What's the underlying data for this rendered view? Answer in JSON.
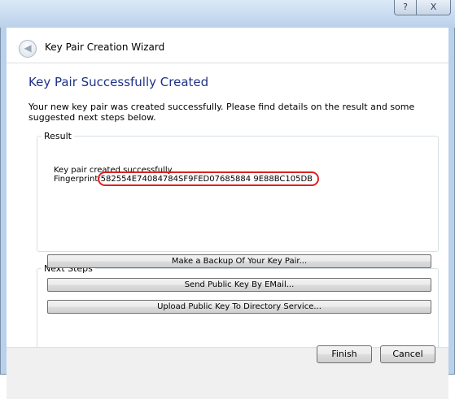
{
  "window": {
    "help_glyph": "?",
    "close_glyph": "X"
  },
  "wizard": {
    "title": "Key Pair Creation Wizard",
    "back_glyph": "◀"
  },
  "page": {
    "heading": "Key Pair Successfully Created",
    "intro": "Your new key pair was created successfully. Please find details on the result and some suggested next steps below."
  },
  "result": {
    "legend": "Result",
    "status_line": "Key pair created successfully.",
    "fingerprint_label": "Fingerprint:",
    "fingerprint_value": "582554E74084784SF9FED07685884 9E88BC105DB"
  },
  "next_steps": {
    "legend": "Next Steps",
    "buttons": [
      "Make a Backup Of Your Key Pair...",
      "Send Public Key By EMail...",
      "Upload Public Key To Directory Service..."
    ]
  },
  "footer": {
    "finish_label": "Finish",
    "cancel_label": "Cancel"
  },
  "colors": {
    "heading": "#1e3287",
    "highlight": "#e02020",
    "chrome": "#b9d1ea"
  }
}
